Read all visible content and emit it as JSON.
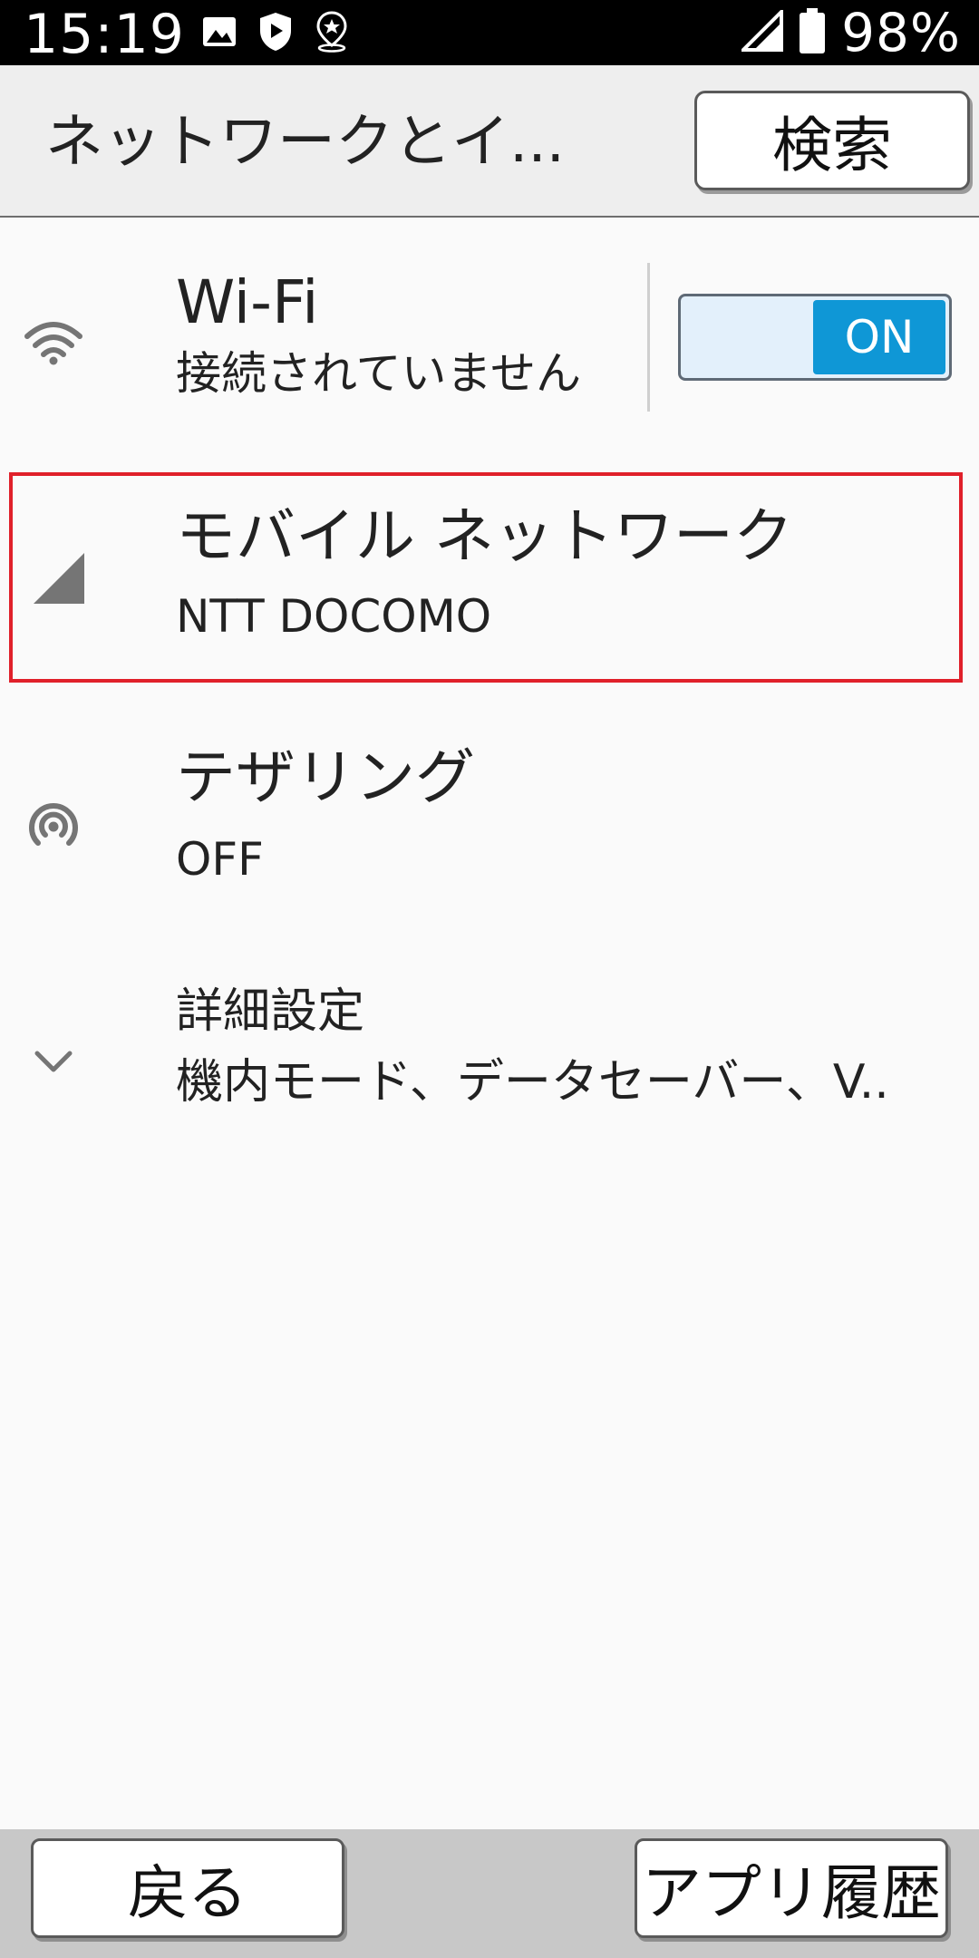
{
  "status_bar": {
    "time": "15:19",
    "battery_percent": "98%",
    "icons_left": [
      "image-icon",
      "shield-icon",
      "location-star-icon"
    ],
    "icons_right": [
      "signal-icon",
      "battery-icon"
    ]
  },
  "toolbar": {
    "title": "ネットワークとイ...",
    "search_label": "検索"
  },
  "network_items": [
    {
      "icon": "wifi-icon",
      "title": "Wi-Fi",
      "subtitle": "接続されていません",
      "toggle_label": "ON",
      "toggle_on": true
    },
    {
      "icon": "cell-signal-icon",
      "title": "モバイル ネットワーク",
      "subtitle": "NTT DOCOMO",
      "highlighted": true
    },
    {
      "icon": "hotspot-icon",
      "title": "テザリング",
      "subtitle": "OFF"
    }
  ],
  "advanced": {
    "icon": "chevron-down-icon",
    "title": "詳細設定",
    "subtitle": "機内モード、データセーバー、V.."
  },
  "bottom_bar": {
    "back_label": "戻る",
    "recent_apps_label": "アプリ履歴"
  },
  "colors": {
    "status_bar_bg": "#000000",
    "toolbar_bg": "#eeeeee",
    "page_bg": "#fafafa",
    "toggle_on": "#0f97d6",
    "toggle_track": "#e3f0fb",
    "highlight_border": "#e0202a",
    "bottom_bar_bg": "#c8c8c8",
    "icon_gray": "#757575"
  }
}
